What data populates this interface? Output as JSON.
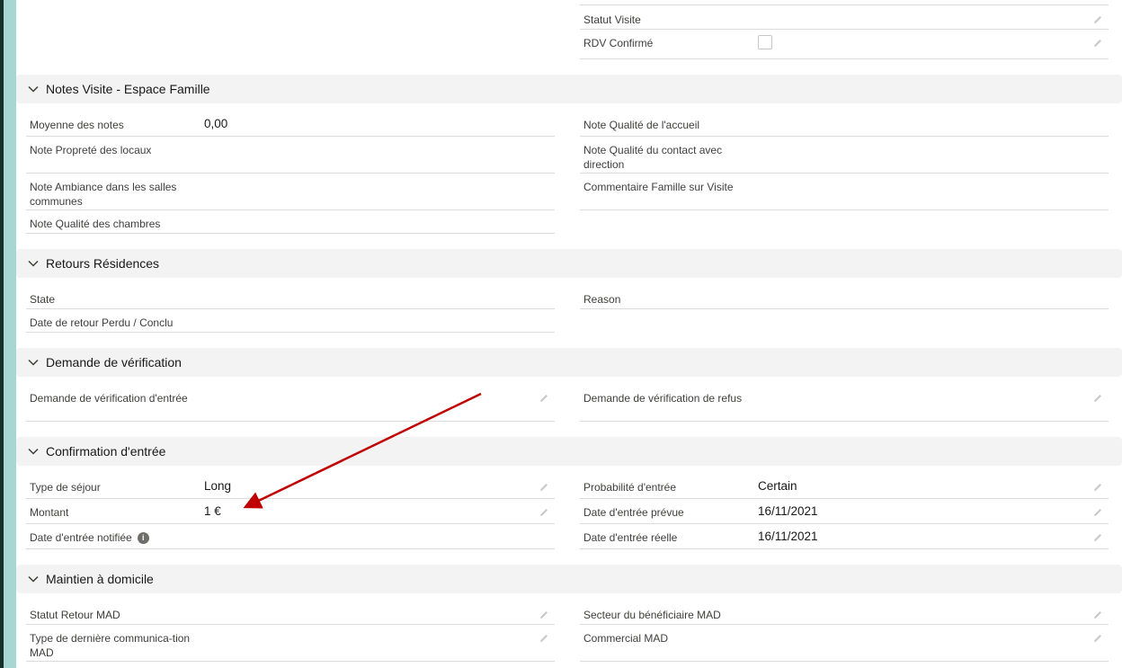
{
  "top": {
    "statut_visite": "Statut Visite",
    "rdv_confirme": "RDV Confirmé"
  },
  "sections": {
    "notes": {
      "title": "Notes Visite - Espace Famille",
      "moyenne_label": "Moyenne des notes",
      "moyenne_value": "0,00",
      "proprete": "Note Propreté des locaux",
      "ambiance": "Note Ambiance dans les salles communes",
      "chambres": "Note Qualité des chambres",
      "accueil": "Note Qualité de l'accueil",
      "contact": "Note Qualité du contact avec direction",
      "commentaire": "Commentaire Famille sur Visite"
    },
    "retours": {
      "title": "Retours Résidences",
      "state": "State",
      "date_retour": "Date de retour Perdu / Conclu",
      "reason": "Reason"
    },
    "verification": {
      "title": "Demande de vérification",
      "entree": "Demande de vérification d'entrée",
      "refus": "Demande de vérification de refus"
    },
    "confirmation": {
      "title": "Confirmation d'entrée",
      "type_sejour_label": "Type de séjour",
      "type_sejour_value": "Long",
      "montant_label": "Montant",
      "montant_value": "1 €",
      "date_notifiee_label": "Date d'entrée notifiée",
      "probabilite_label": "Probabilité d'entrée",
      "probabilite_value": "Certain",
      "date_prevue_label": "Date d'entrée prévue",
      "date_prevue_value": "16/11/2021",
      "date_reelle_label": "Date d'entrée réelle",
      "date_reelle_value": "16/11/2021"
    },
    "maintien": {
      "title": "Maintien à domicile",
      "statut_retour": "Statut Retour MAD",
      "type_communication": "Type de dernière communica-tion MAD",
      "secteur": "Secteur du bénéficiaire MAD",
      "commercial": "Commercial MAD"
    }
  },
  "icons": {
    "chevron": "chevron-down-icon",
    "edit": "pencil-icon",
    "info": "info-icon"
  },
  "colors": {
    "annotation_arrow": "#c00000",
    "section_bg": "#f3f3f3"
  }
}
